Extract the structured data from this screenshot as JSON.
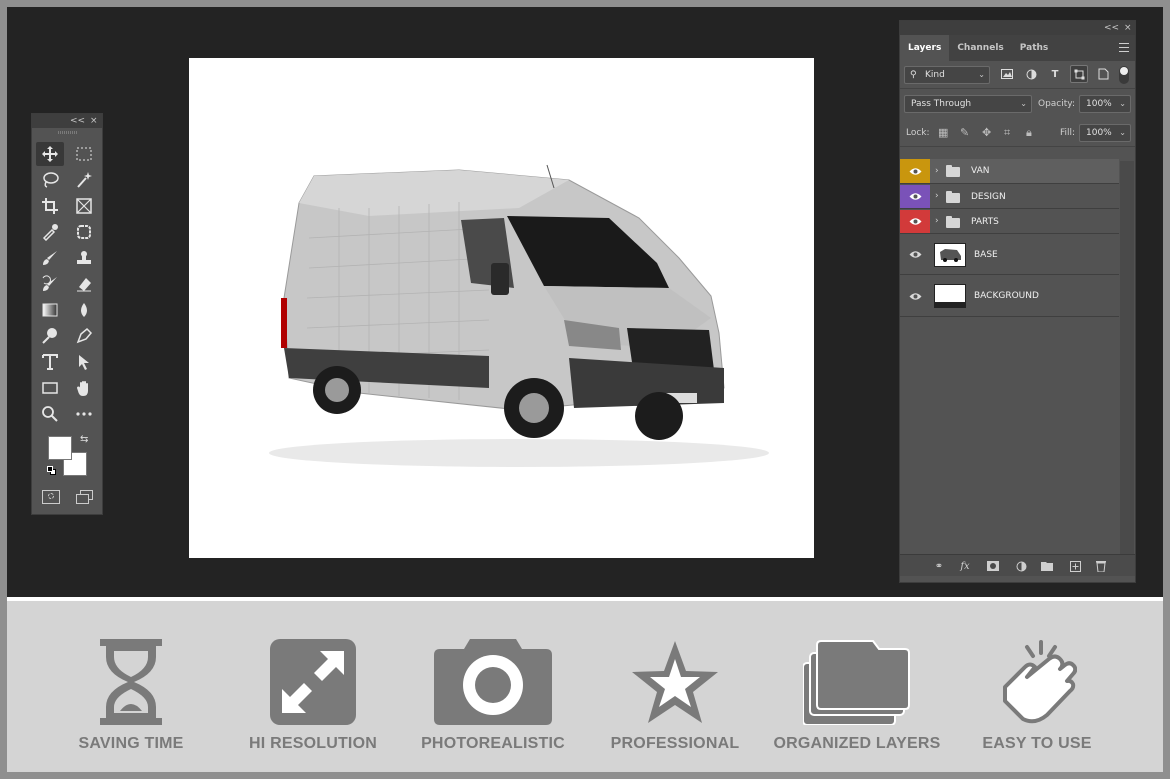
{
  "tools_panel": {
    "collapse_label": "<<",
    "close_label": "×"
  },
  "layers_panel": {
    "collapse_label": "<<",
    "close_label": "×",
    "tabs": [
      {
        "label": "Layers",
        "active": true
      },
      {
        "label": "Channels",
        "active": false
      },
      {
        "label": "Paths",
        "active": false
      }
    ],
    "filter": {
      "kind_label": "Kind"
    },
    "blend_mode": "Pass Through",
    "opacity_label": "Opacity:",
    "opacity_value": "100%",
    "lock_label": "Lock:",
    "fill_label": "Fill:",
    "fill_value": "100%",
    "layers": [
      {
        "name": "VAN",
        "type": "group",
        "eye_color": "#c9960e",
        "active": true
      },
      {
        "name": "DESIGN",
        "type": "group",
        "eye_color": "#7a52b8",
        "active": false
      },
      {
        "name": "PARTS",
        "type": "group",
        "eye_color": "#d23a3a",
        "active": false
      },
      {
        "name": "BASE",
        "type": "image",
        "eye_color": "",
        "active": false
      },
      {
        "name": "BACKGROUND",
        "type": "image",
        "eye_color": "",
        "active": false
      }
    ],
    "footer_icons": [
      "link-icon",
      "fx-icon",
      "mask-icon",
      "adjustment-icon",
      "folder-icon",
      "new-layer-icon",
      "trash-icon"
    ],
    "fx_label": "fx"
  },
  "features": [
    {
      "label": "SAVING TIME",
      "icon": "hourglass-icon"
    },
    {
      "label": "HI RESOLUTION",
      "icon": "expand-icon"
    },
    {
      "label": "PHOTOREALISTIC",
      "icon": "camera-icon"
    },
    {
      "label": "PROFESSIONAL",
      "icon": "star-icon"
    },
    {
      "label": "ORGANIZED LAYERS",
      "icon": "layers-folder-icon"
    },
    {
      "label": "EASY TO USE",
      "icon": "hand-tap-icon"
    }
  ],
  "colors": {
    "workspace": "#232323",
    "panel": "#535353",
    "feature_icon": "#7a7a7a",
    "feature_bar": "#d4d4d4"
  }
}
